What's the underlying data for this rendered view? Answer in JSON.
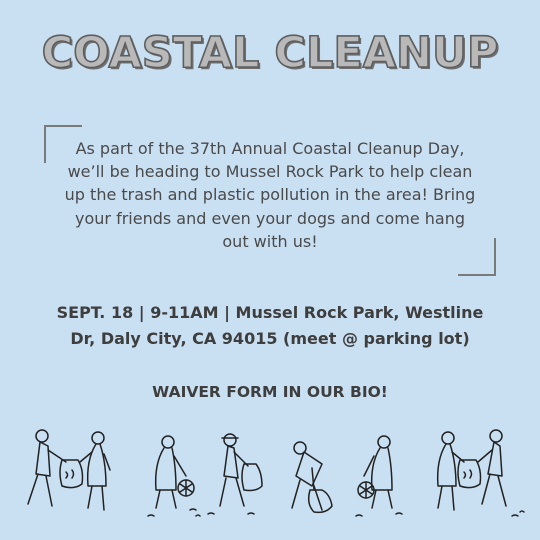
{
  "title": "COASTAL CLEANUP",
  "intro": "As part of the 37th Annual Coastal Cleanup Day, we’ll be heading to Mussel Rock Park to help clean up the trash and plastic pollution in the area! Bring your friends and even your dogs and come hang out with us!",
  "event_line_1": "SEPT. 18 | 9-11AM | Mussel Rock Park, Westline",
  "event_line_2": "Dr, Daly City, CA 94015 (meet @ parking lot)",
  "waiver": "WAIVER FORM IN OUR BIO!",
  "colors": {
    "background": "#c9dff2",
    "title_fill": "#b9b9b9",
    "text": "#4a4a4a",
    "line_art": "#222222"
  },
  "illustration": "volunteers-picking-up-trash-line-art"
}
